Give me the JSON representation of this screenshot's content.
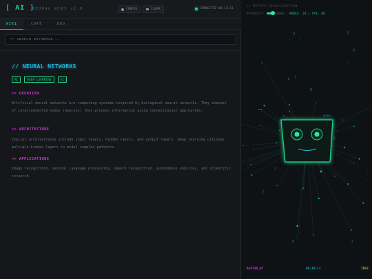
{
  "header": {
    "logo": "AI",
    "logo_open": "[",
    "logo_close": "]",
    "app_title": "NEURAL WIKI v2.0",
    "config_label": "CONFIG",
    "clear_label": "CLEAR",
    "connection_text": "CONNECTED 06:16:11"
  },
  "tabs": [
    {
      "label": "WIKI",
      "active": true
    },
    {
      "label": "CHAT",
      "active": false
    },
    {
      "label": "DOO",
      "active": false
    }
  ],
  "search": {
    "prefix": ">>",
    "placeholder": "SEARCH DATABASE..."
  },
  "article": {
    "title": "// NEURAL NETWORKS",
    "tags": [
      "ML",
      "DEEP LEARNING",
      "AI"
    ],
    "sections": [
      {
        "heading": ">> OVERVIEW",
        "body": "Artificial neural networks are computing systems inspired by biological neural networks. They consist of interconnected nodes (neurons) that process information using connectionist approaches."
      },
      {
        "heading": ">> ARCHITECTURE",
        "body": "Typical architectures include input layers, hidden layers, and output layers. Deep learning utilizes multiple hidden layers to model complex patterns."
      },
      {
        "heading": ">> APPLICATIONS",
        "body": "Image recognition, natural language processing, speech recognition, autonomous vehicles, and scientific research."
      }
    ]
  },
  "visualization": {
    "title": "// MATRIX VISUALIZATION",
    "intensity_label": "INTENSITY",
    "intensity_value": 0.35,
    "nodes_fps": "NODES: 24 | FPS: 60",
    "avatar_tag": "NEURAL",
    "glyphs": [
      "0",
      "1",
      "9",
      "Z",
      "5",
      "E",
      "0",
      "B",
      "1",
      "7",
      "8",
      "Σ"
    ]
  },
  "status": {
    "avatar_id": "AVATAR_07",
    "clock": "06:16:11",
    "state": "IDLE"
  },
  "colors": {
    "accent_green": "#1fd38a",
    "accent_cyan": "#1fb8d8",
    "accent_magenta": "#d03ae0",
    "status_amber": "#d8a82a"
  },
  "icons": {
    "config": "gear-icon",
    "clear": "trash-icon",
    "connection": "status-dot-icon"
  }
}
